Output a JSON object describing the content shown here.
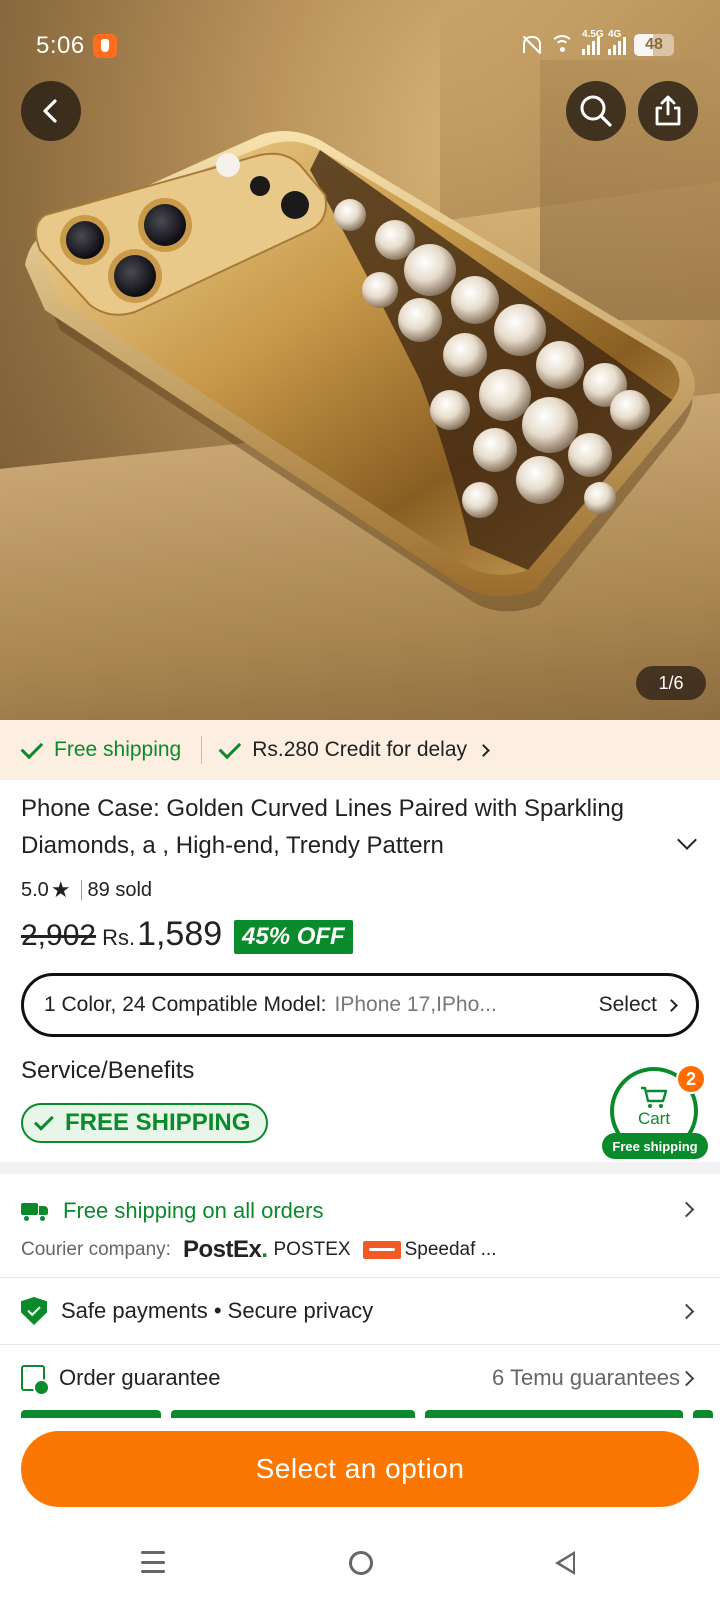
{
  "status_bar": {
    "time": "5:06",
    "network_1": "4.5G",
    "network_2": "4G",
    "battery": "48"
  },
  "hero": {
    "image_counter": "1/6",
    "icons": [
      "back-icon",
      "search-icon",
      "share-icon"
    ]
  },
  "shipping_strip": {
    "free_shipping": "Free shipping",
    "credit_for_delay": "Rs.280 Credit for delay"
  },
  "product": {
    "title": "Phone Case: Golden Curved Lines Paired with Sparkling Diamonds, a , High-end, Trendy Pattern",
    "rating": "5.0",
    "sold": "89 sold",
    "old_price": "2,902",
    "currency": "Rs.",
    "price": "1,589",
    "discount": "45% OFF"
  },
  "variant": {
    "label": "1 Color, 24 Compatible Model:",
    "value": "IPhone 17,IPho...",
    "select": "Select"
  },
  "service": {
    "title": "Service/Benefits",
    "badge": "FREE SHIPPING"
  },
  "cart": {
    "label": "Cart",
    "count": "2",
    "free_shipping": "Free shipping"
  },
  "rows": {
    "shipping_title": "Free shipping on all orders",
    "courier_label": "Courier company:",
    "courier_1_logo": "PostEx",
    "courier_1_name": "POSTEX",
    "courier_2_name": "Speedaf ...",
    "safe_payments": "Safe payments • Secure privacy",
    "order_guarantee": "Order guarantee",
    "guarantee_count": "6 Temu guarantees"
  },
  "cta": {
    "label": "Select an option"
  },
  "colors": {
    "accent_orange": "#fb7701",
    "green": "#0a8a2a",
    "strip_bg": "#fdeee2"
  }
}
